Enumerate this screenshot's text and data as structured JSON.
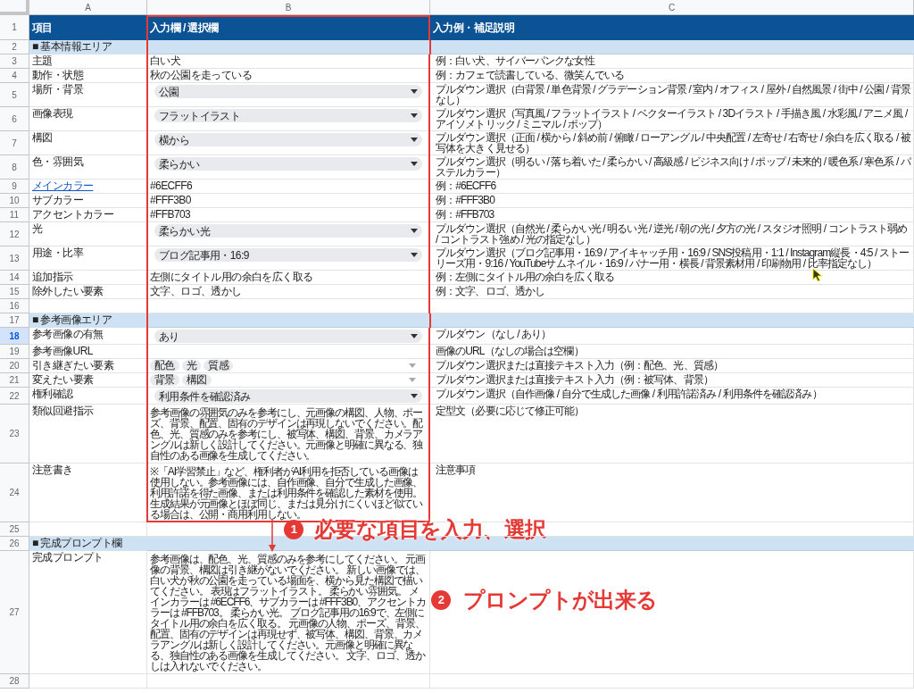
{
  "column_headers": [
    "A",
    "B",
    "C"
  ],
  "rows": [
    {
      "number": "1",
      "kind": "header",
      "selected": false,
      "framed": true,
      "cells": [
        "項目",
        "入力欄 / 選択欄",
        "入力例・補足説明"
      ]
    },
    {
      "number": "2",
      "kind": "section",
      "selected": false,
      "framed": true,
      "title": "■ 基本情報エリア"
    },
    {
      "number": "3",
      "kind": "data",
      "selected": false,
      "framed": true,
      "item": {
        "text": "主題",
        "link": false
      },
      "input": {
        "kind": "text",
        "text": "白い犬"
      },
      "note": "例：白い犬、サイバーパンクな女性"
    },
    {
      "number": "4",
      "kind": "data",
      "selected": false,
      "framed": true,
      "item": {
        "text": "動作・状態",
        "link": false
      },
      "input": {
        "kind": "text",
        "text": "秋の公園を走っている"
      },
      "note": "例：カフェで読書している、微笑んでいる"
    },
    {
      "number": "5",
      "kind": "data",
      "selected": false,
      "framed": true,
      "item": {
        "text": "場所・背景",
        "link": false
      },
      "input": {
        "kind": "dropdown",
        "value": "公園"
      },
      "note": "プルダウン選択（白背景 / 単色背景 / グラデーション背景 / 室内 / オフィス / 屋外 / 自然風景 / 街中 / 公園 / 背景なし）"
    },
    {
      "number": "6",
      "kind": "data",
      "selected": false,
      "framed": true,
      "item": {
        "text": "画像表現",
        "link": false
      },
      "input": {
        "kind": "dropdown",
        "value": "フラットイラスト"
      },
      "note": "プルダウン選択（写真風 / フラットイラスト / ベクターイラスト / 3Dイラスト / 手描き風 / 水彩風 / アニメ風 / アイソメトリック / ミニマル / ポップ）"
    },
    {
      "number": "7",
      "kind": "data",
      "selected": false,
      "framed": true,
      "item": {
        "text": "構図",
        "link": false
      },
      "input": {
        "kind": "dropdown",
        "value": "横から"
      },
      "note": "プルダウン選択（正面 / 横から / 斜め前 / 俯瞰 / ローアングル / 中央配置 / 左寄せ / 右寄せ / 余白を広く取る / 被写体を大きく見せる）"
    },
    {
      "number": "8",
      "kind": "data",
      "selected": false,
      "framed": true,
      "item": {
        "text": "色・雰囲気",
        "link": false
      },
      "input": {
        "kind": "dropdown",
        "value": "柔らかい"
      },
      "note": "プルダウン選択（明るい / 落ち着いた / 柔らかい / 高級感 / ビジネス向け / ポップ / 未来的 / 暖色系 / 寒色系 / パステルカラー）"
    },
    {
      "number": "9",
      "kind": "data",
      "selected": false,
      "framed": true,
      "item": {
        "text": "メインカラー",
        "link": true
      },
      "input": {
        "kind": "text",
        "text": "#6ECFF6"
      },
      "note": "例：#6ECFF6"
    },
    {
      "number": "10",
      "kind": "data",
      "selected": false,
      "framed": true,
      "item": {
        "text": "サブカラー",
        "link": false
      },
      "input": {
        "kind": "text",
        "text": "#FFF3B0"
      },
      "note": "例：#FFF3B0"
    },
    {
      "number": "11",
      "kind": "data",
      "selected": false,
      "framed": true,
      "item": {
        "text": "アクセントカラー",
        "link": false
      },
      "input": {
        "kind": "text",
        "text": "#FFB703"
      },
      "note": "例：#FFB703"
    },
    {
      "number": "12",
      "kind": "data",
      "selected": false,
      "framed": true,
      "item": {
        "text": "光",
        "link": false
      },
      "input": {
        "kind": "dropdown",
        "value": "柔らかい光"
      },
      "note": "プルダウン選択（自然光 / 柔らかい光 / 明るい光 / 逆光 / 朝の光 / 夕方の光 / スタジオ照明 / コントラスト弱め / コントラスト強め / 光の指定なし）"
    },
    {
      "number": "13",
      "kind": "data",
      "selected": false,
      "framed": true,
      "item": {
        "text": "用途・比率",
        "link": false
      },
      "input": {
        "kind": "dropdown",
        "value": "ブログ記事用・16:9"
      },
      "note": "プルダウン選択（ブログ記事用・16:9 / アイキャッチ用・16:9 / SNS投稿用・1:1 / Instagram縦長・4:5 / ストーリーズ用・9:16 / YouTubeサムネイル・16:9 / バナー用・横長 / 背景素材用 / 印刷物用 / 比率指定なし）"
    },
    {
      "number": "14",
      "kind": "data",
      "selected": false,
      "framed": true,
      "item": {
        "text": "追加指示",
        "link": false
      },
      "input": {
        "kind": "text",
        "text": "左側にタイトル用の余白を広く取る"
      },
      "note": "例：左側にタイトル用の余白を広く取る"
    },
    {
      "number": "15",
      "kind": "data",
      "selected": false,
      "framed": true,
      "item": {
        "text": "除外したい要素",
        "link": false
      },
      "input": {
        "kind": "text",
        "text": "文字、ロゴ、透かし"
      },
      "note": "例：文字、ロゴ、透かし"
    },
    {
      "number": "16",
      "kind": "blank",
      "selected": false,
      "framed": true
    },
    {
      "number": "17",
      "kind": "section",
      "selected": false,
      "framed": true,
      "title": "■ 参考画像エリア"
    },
    {
      "number": "18",
      "kind": "data",
      "selected": true,
      "framed": true,
      "item": {
        "text": "参考画像の有無",
        "link": false
      },
      "input": {
        "kind": "dropdown",
        "value": "あり"
      },
      "note": "プルダウン（なし / あり）"
    },
    {
      "number": "19",
      "kind": "data",
      "selected": false,
      "framed": true,
      "item": {
        "text": "参考画像URL",
        "link": false
      },
      "input": {
        "kind": "empty"
      },
      "note": "画像のURL（なしの場合は空欄）"
    },
    {
      "number": "20",
      "kind": "data",
      "selected": false,
      "framed": true,
      "item": {
        "text": "引き継ぎたい要素",
        "link": false
      },
      "input": {
        "kind": "chips",
        "chips": [
          "配色",
          "光",
          "質感"
        ]
      },
      "note": "プルダウン選択または直接テキスト入力（例：配色、光、質感）"
    },
    {
      "number": "21",
      "kind": "data",
      "selected": false,
      "framed": true,
      "item": {
        "text": "変えたい要素",
        "link": false
      },
      "input": {
        "kind": "chips",
        "chips": [
          "背景",
          "構図"
        ]
      },
      "note": "プルダウン選択または直接テキスト入力（例：被写体、背景）"
    },
    {
      "number": "22",
      "kind": "data",
      "selected": false,
      "framed": true,
      "item": {
        "text": "権利確認",
        "link": false
      },
      "input": {
        "kind": "dropdown",
        "value": "利用条件を確認済み"
      },
      "note": "プルダウン選択（自作画像 / 自分で生成した画像 / 利用許諾済み / 利用条件を確認済み）"
    },
    {
      "number": "23",
      "kind": "data",
      "selected": false,
      "framed": true,
      "item": {
        "text": "類似回避指示",
        "link": false
      },
      "input": {
        "kind": "long",
        "text": "参考画像の雰囲気のみを参考にし、元画像の構図、人物、ポーズ、背景、配置、固有のデザインは再現しないでください。配色、光、質感のみを参考にし、被写体、構図、背景、カメラアングルは新しく設計してください。元画像と明確に異なる、独自性のある画像を生成してください。"
      },
      "note": "定型文（必要に応じて修正可能）"
    },
    {
      "number": "24",
      "kind": "data",
      "selected": false,
      "framed": true,
      "item": {
        "text": "注意書き",
        "link": false
      },
      "input": {
        "kind": "long",
        "text": "※「AI学習禁止」など、権利者がAI利用を拒否している画像は使用しない。参考画像には、自作画像、自分で生成した画像、利用許諾を得た画像、または利用条件を確認した素材を使用。生成結果が元画像とほぼ同じ、または見分けにくいほど似ている場合は、公開・商用利用しない。"
      },
      "note": "注意事項"
    },
    {
      "number": "25",
      "kind": "blank",
      "selected": false,
      "framed": false,
      "annotation": {
        "number": "1",
        "text": "必要な項目を入力、選択"
      }
    },
    {
      "number": "26",
      "kind": "section",
      "selected": false,
      "framed": false,
      "title": "■ 完成プロンプト欄"
    },
    {
      "number": "27",
      "kind": "data",
      "selected": false,
      "framed": false,
      "item": {
        "text": "完成プロンプト",
        "link": false
      },
      "input": {
        "kind": "long",
        "text": "参考画像は、配色、光、質感のみを参考にしてください。 元画像の背景、構図は引き継がないでください。 新しい画像では、白い犬が秋の公園を走っている場面を、横から見た構図で描いてください。 表現はフラットイラスト。 柔らかい雰囲気。 メインカラーは #6ECFF6、サブカラーは #FFF3B0、アクセントカラーは #FFB703。 柔らかい光。 ブログ記事用の16:9で、左側にタイトル用の余白を広く取る。 元画像の人物、ポーズ、背景、配置、固有のデザインは再現せず、被写体、構図、背景、カメラアングルは新しく設計してください。元画像と明確に異なる、独自性のある画像を生成してください。 文字、ロゴ、透かしは入れないでください。"
      },
      "annotation": {
        "number": "2",
        "text": "プロンプトが出来る"
      }
    },
    {
      "number": "28",
      "kind": "blank",
      "selected": false,
      "framed": false
    }
  ]
}
